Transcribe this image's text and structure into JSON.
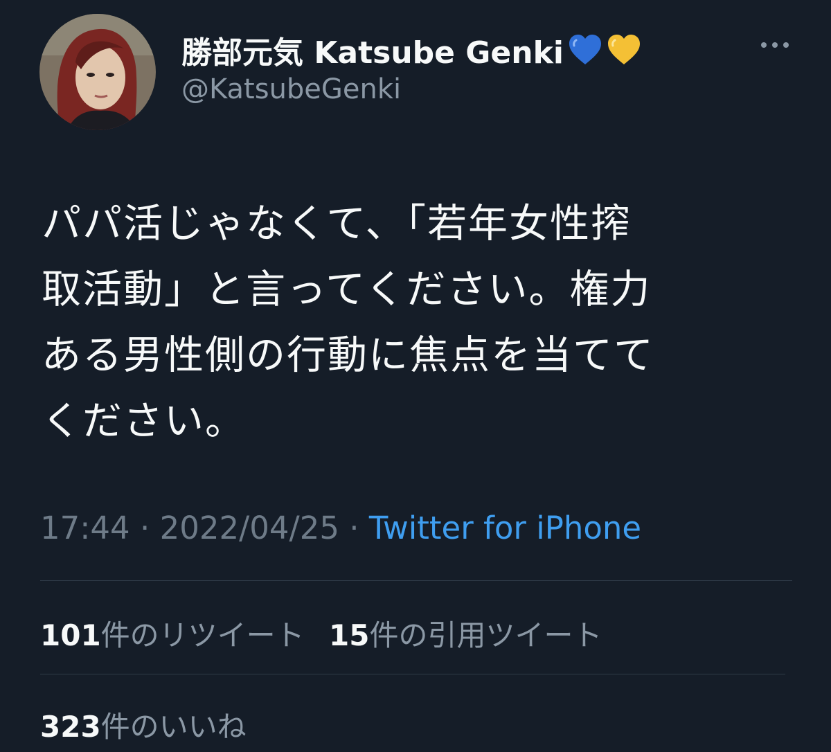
{
  "author": {
    "display_name": "勝部元気 Katsube Genki",
    "handle": "@KatsubeGenki",
    "emoji_icons": [
      "blue-heart-icon",
      "yellow-heart-icon"
    ],
    "more_icon": "more-options-icon"
  },
  "tweet": {
    "lines": [
      "パパ活じゃなくて、「若年女性搾",
      "取活動」と言ってください。権力",
      "ある男性側の行動に焦点を当てて",
      "ください。"
    ],
    "time": "17:44",
    "date": "2022/04/25",
    "source": "Twitter for iPhone",
    "separator": " · "
  },
  "stats": {
    "retweets_count": "101",
    "retweets_label": "件のリツイート",
    "quotes_count": "15",
    "quotes_label": "件の引用ツイート",
    "likes_count": "323",
    "likes_label": "件のいいね"
  },
  "colors": {
    "background": "#151d28",
    "text": "#f7f9f9",
    "secondary": "#8b98a5",
    "link": "#3f9ef0",
    "divider": "#2f3b48"
  }
}
